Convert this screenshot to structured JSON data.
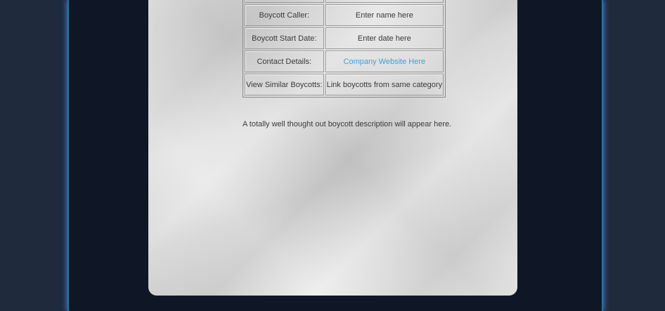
{
  "details_table": {
    "rows": [
      {
        "label": "Boycott Caller:",
        "value": "Enter name here"
      },
      {
        "label": "Boycott Start Date:",
        "value": "Enter date here"
      },
      {
        "label": "Contact Details:",
        "value": "Company Website Here"
      },
      {
        "label": "View Similar Boycotts:",
        "value": "Link boycotts from same category"
      }
    ]
  },
  "description": "A totally well thought out boycott description will appear here.",
  "colors": {
    "page_background": "#1f2b3d",
    "column_background": "#0f1626",
    "column_glow": "#2e6fa8",
    "paper": "#dcdcdc",
    "link": "#3aa0dc",
    "text": "#3a3a3a"
  }
}
